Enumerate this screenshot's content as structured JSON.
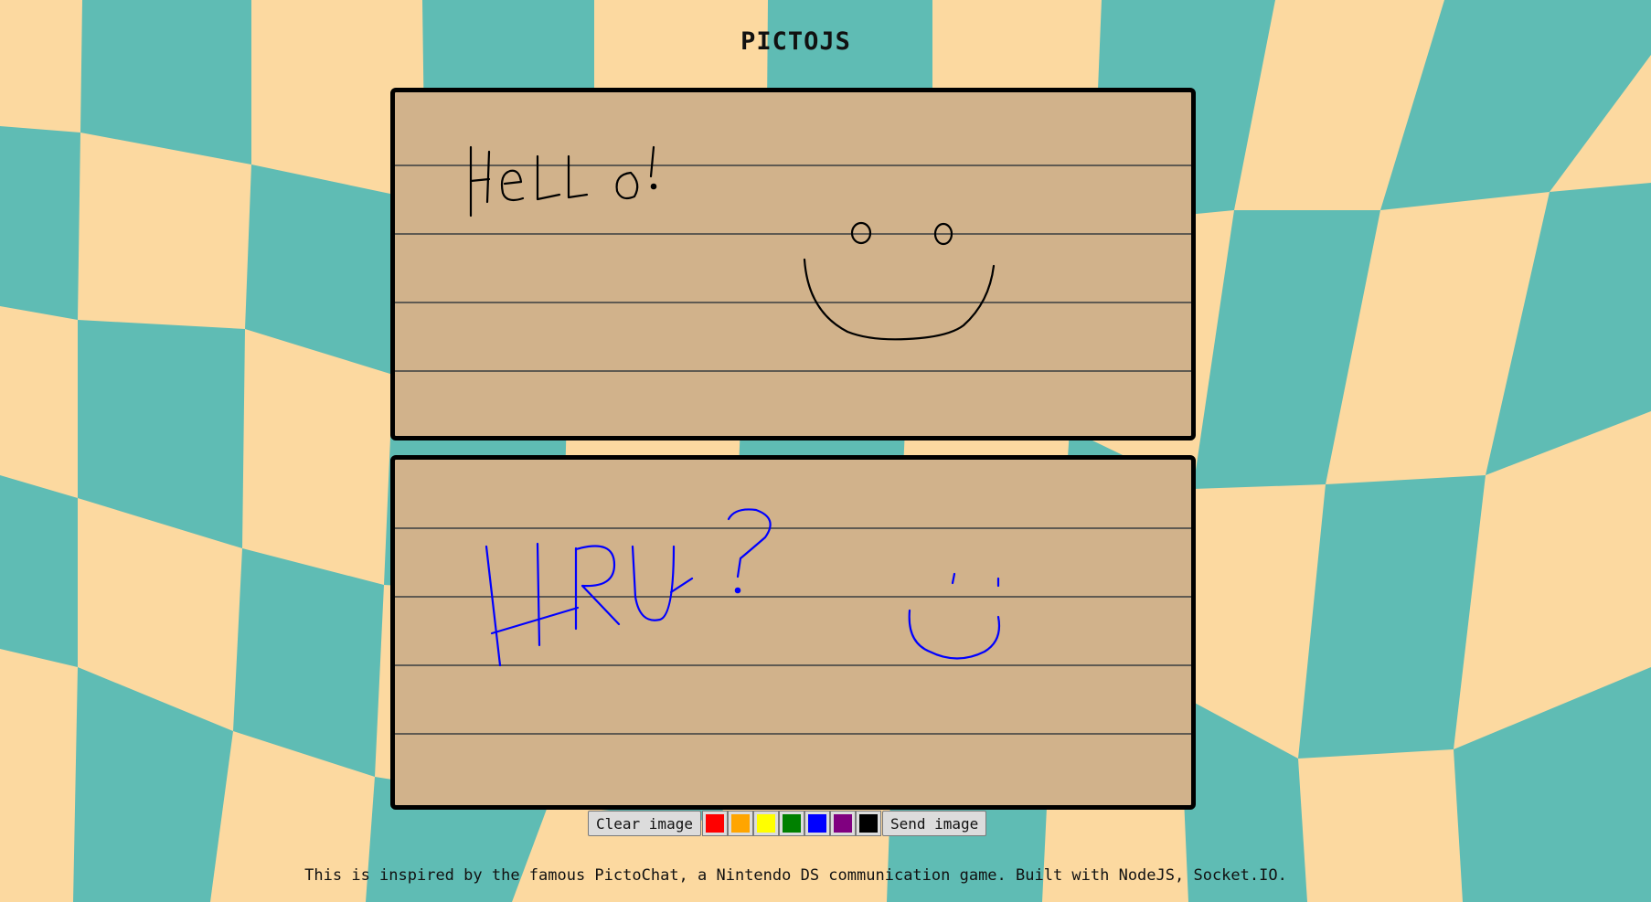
{
  "app": {
    "title": "PICTOJS",
    "footer": "This is inspired by the famous PictoChat, a Nintendo DS communication game. Built with NodeJS, Socket.IO."
  },
  "theme": {
    "background_cream": "#fcd9a0",
    "background_teal": "#5fbcb4",
    "board_fill": "#d1b28b",
    "board_border": "#000000",
    "rule_line": "#5f5a52"
  },
  "received_message": {
    "ink_color": "#000000",
    "drawing": "handwritten 'Hello!' with a smiley face"
  },
  "draft_canvas": {
    "ink_color": "#0000ff",
    "drawing": "handwritten 'HRU?' with a small smile"
  },
  "toolbar": {
    "clear_label": "Clear image",
    "send_label": "Send image",
    "colors": [
      {
        "name": "red",
        "hex": "#ff0000"
      },
      {
        "name": "orange",
        "hex": "#ffa500"
      },
      {
        "name": "yellow",
        "hex": "#ffff00"
      },
      {
        "name": "green",
        "hex": "#008000"
      },
      {
        "name": "blue",
        "hex": "#0000ff"
      },
      {
        "name": "purple",
        "hex": "#800080"
      },
      {
        "name": "black",
        "hex": "#000000"
      }
    ]
  }
}
